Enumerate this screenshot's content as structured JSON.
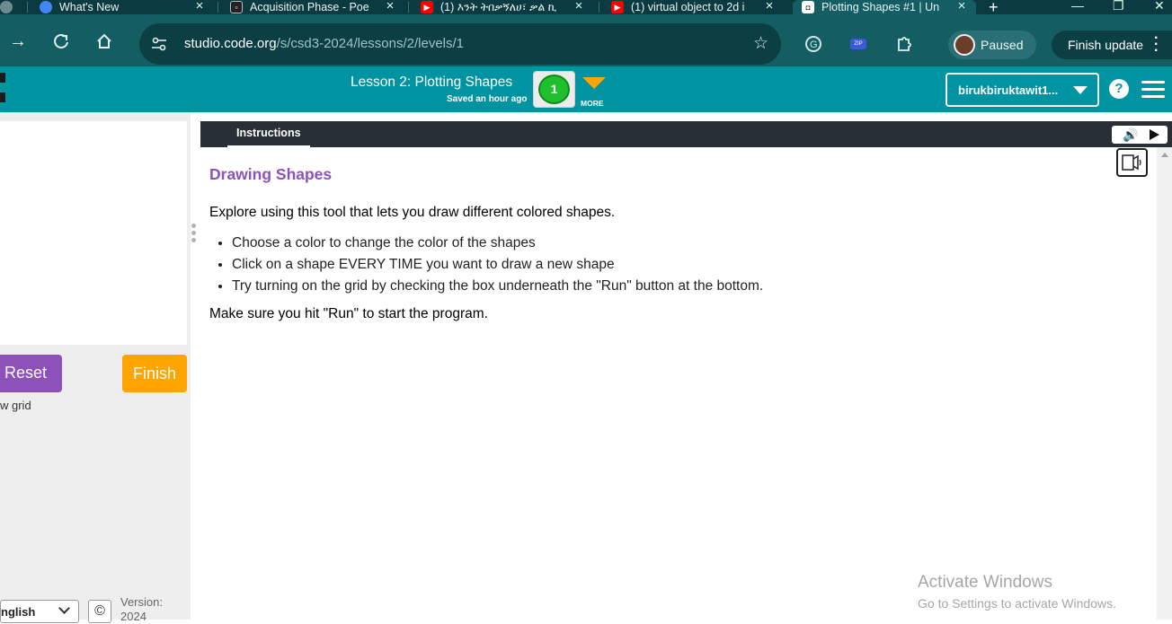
{
  "browser": {
    "tabs": [
      {
        "title": "What's New",
        "favicon": "chrome-icon",
        "color": "#4285f4"
      },
      {
        "title": "Acquisition Phase - Poe",
        "favicon": "poe-icon",
        "color": "#222222"
      },
      {
        "title": "(1) እንት ትበቃኝለሀ፣ ቃል ኪ",
        "favicon": "youtube-icon",
        "color": "#ff0000"
      },
      {
        "title": "(1) virtual object to 2d i",
        "favicon": "youtube-icon",
        "color": "#ff0000"
      },
      {
        "title": "Plotting Shapes #1 | Un",
        "favicon": "codeorg-icon",
        "color": "#ffffff"
      }
    ],
    "new_tab": "+",
    "window_controls": [
      "—",
      "❐",
      "✕"
    ],
    "url": {
      "host": "studio.code.org",
      "path": "/s/csd3-2024/lessons/2/levels/1"
    },
    "profile": {
      "label": "Paused"
    },
    "finish_update": "Finish update",
    "extensions": [
      "grammarly-icon",
      "zip-extension-icon",
      "puzzle-extensions-icon"
    ]
  },
  "header": {
    "lesson_title": "Lesson 2: Plotting Shapes",
    "saved": "Saved an hour ago",
    "level_number": "1",
    "more_label": "MORE",
    "username": "birukbiruktawit1...",
    "help": "?",
    "accent": "#0094a3"
  },
  "left_panel": {
    "reset_label": "Reset",
    "finish_label": "Finish",
    "grid_label": "w grid",
    "language": "nglish",
    "copyright": "©",
    "version_label": "Version:",
    "version_value": "2024"
  },
  "instructions": {
    "tab_label": "Instructions",
    "heading": "Drawing Shapes",
    "intro": "Explore using this tool that lets you draw different colored shapes.",
    "bullets": [
      "Choose a color to change the color of the shapes",
      "Click on a shape EVERY TIME you want to draw a new shape",
      "Try turning on the grid by checking the box underneath the \"Run\" button at the bottom."
    ],
    "outro": "Make sure you hit \"Run\" to start the program.",
    "heading_color": "#8c52ba"
  },
  "watermark": {
    "line1": "Activate Windows",
    "line2": "Go to Settings to activate Windows."
  }
}
